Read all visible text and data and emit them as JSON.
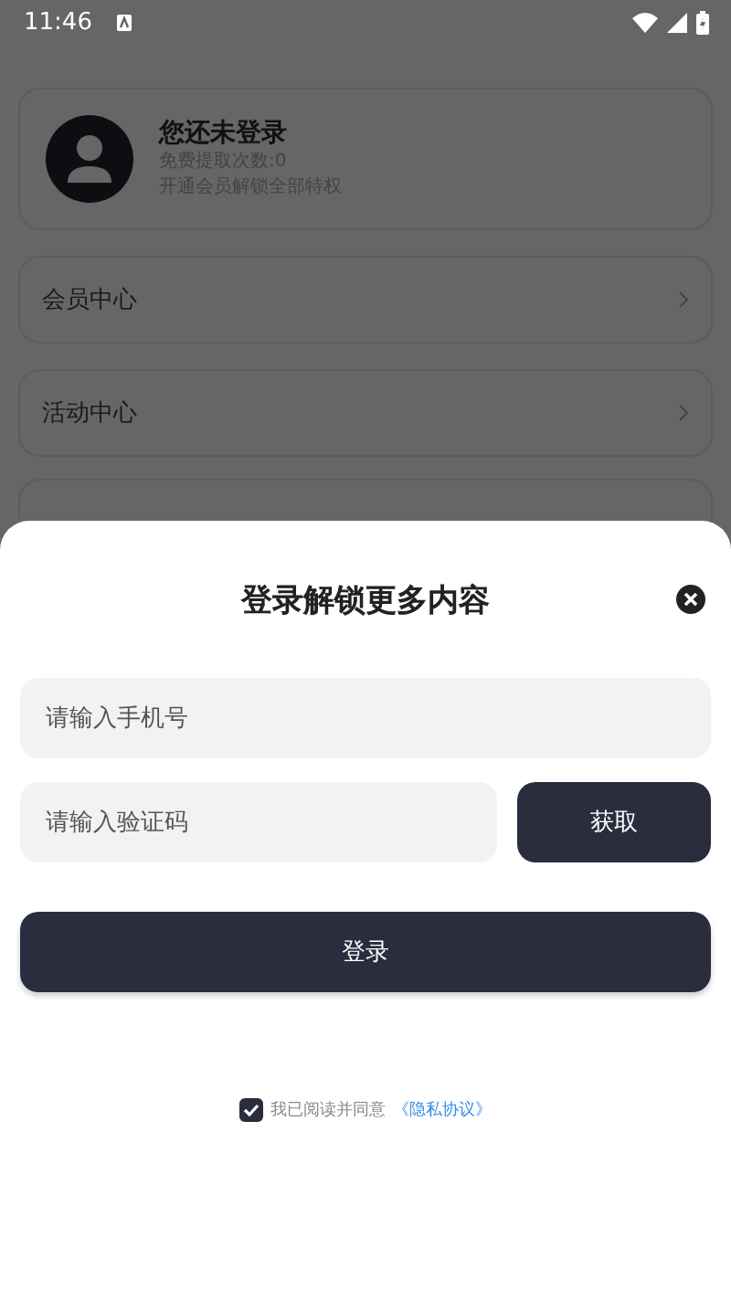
{
  "status_bar": {
    "time": "11:46"
  },
  "profile": {
    "title": "您还未登录",
    "quota": "免费提取次数:0",
    "promo": "开通会员解锁全部特权"
  },
  "menu": [
    {
      "label": "会员中心"
    },
    {
      "label": "活动中心"
    }
  ],
  "login_sheet": {
    "title": "登录解锁更多内容",
    "phone": {
      "placeholder": "请输入手机号"
    },
    "code": {
      "placeholder": "请输入验证码"
    },
    "get_code": "获取",
    "submit": "登录",
    "agreement": {
      "checked": true,
      "text": "我已阅读并同意",
      "link": "《隐私协议》"
    }
  }
}
